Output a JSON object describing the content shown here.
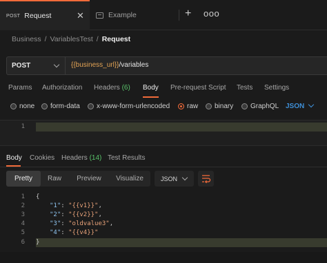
{
  "tabs": [
    {
      "method": "POST",
      "title": "Request",
      "active": true
    },
    {
      "title": "Example",
      "active": false
    }
  ],
  "tab_actions": {
    "new": "+",
    "more": "ooo"
  },
  "breadcrumb": [
    "Business",
    "VariablesTest",
    "Request"
  ],
  "request": {
    "method": "POST",
    "url_variable": "{{business_url}}",
    "url_path": "/variables"
  },
  "request_tabs": [
    {
      "label": "Params"
    },
    {
      "label": "Authorization"
    },
    {
      "label": "Headers",
      "count": "(6)"
    },
    {
      "label": "Body",
      "active": true
    },
    {
      "label": "Pre-request Script"
    },
    {
      "label": "Tests"
    },
    {
      "label": "Settings"
    }
  ],
  "body_types": [
    {
      "label": "none"
    },
    {
      "label": "form-data"
    },
    {
      "label": "x-www-form-urlencoded"
    },
    {
      "label": "raw",
      "selected": true
    },
    {
      "label": "binary"
    },
    {
      "label": "GraphQL"
    }
  ],
  "body_format": "JSON",
  "request_editor": {
    "line_numbers": [
      "1"
    ]
  },
  "response_tabs": [
    {
      "label": "Body",
      "active": true
    },
    {
      "label": "Cookies"
    },
    {
      "label": "Headers",
      "count": "(14)"
    },
    {
      "label": "Test Results"
    }
  ],
  "view_modes": [
    "Pretty",
    "Raw",
    "Preview",
    "Visualize"
  ],
  "active_view": "Pretty",
  "response_format": "JSON",
  "response_lines": [
    {
      "n": "1",
      "text": "{"
    },
    {
      "n": "2",
      "key": "\"1\"",
      "value": "\"{{v1}}\""
    },
    {
      "n": "3",
      "key": "\"2\"",
      "value": "\"{{v2}}\""
    },
    {
      "n": "4",
      "key": "\"3\"",
      "value": "\"oldvalue3\""
    },
    {
      "n": "5",
      "key": "\"4\"",
      "value": "\"{{v4}}\""
    },
    {
      "n": "6",
      "text": "}"
    }
  ],
  "colors": {
    "accent": "#f26b3a",
    "variable": "#e3a354",
    "link": "#3e8fd7",
    "count": "#59c26a"
  }
}
